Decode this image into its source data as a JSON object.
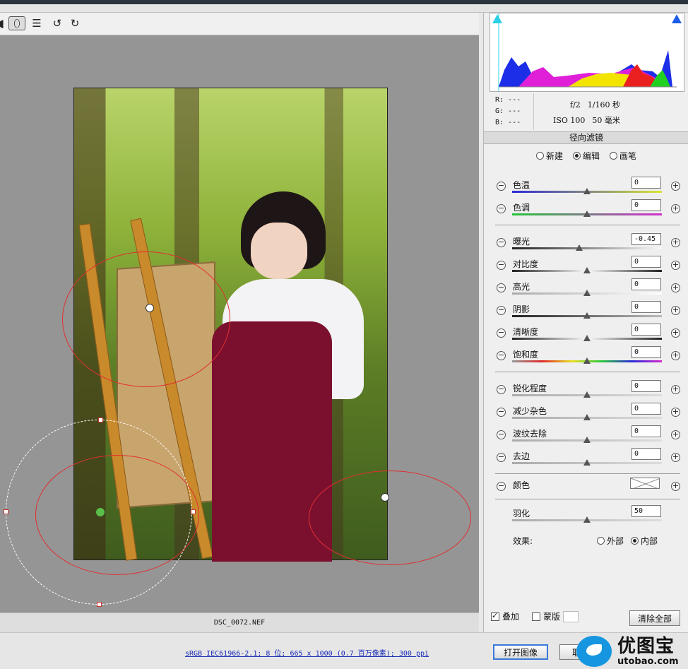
{
  "toolbar": {
    "icons": [
      "zoom-icon",
      "radial-filter-icon",
      "list-icon",
      "rotate-left-icon",
      "rotate-right-icon"
    ],
    "active": "radial-filter-icon"
  },
  "canvas": {
    "filename": "DSC_0072.NEF"
  },
  "info": {
    "r": "R: ---",
    "g": "G: ---",
    "b": "B: ---",
    "aperture": "f/2",
    "shutter": "1/160 秒",
    "iso": "ISO 100",
    "focal": "50 毫米"
  },
  "panel": {
    "title": "径向滤镜",
    "modes": [
      {
        "label": "新建",
        "selected": false
      },
      {
        "label": "编辑",
        "selected": true
      },
      {
        "label": "画笔",
        "selected": false
      }
    ],
    "sliders": [
      {
        "label": "色温",
        "value": "0",
        "level": 0.5
      },
      {
        "label": "色调",
        "value": "0",
        "level": 0.5
      },
      {
        "label": "曝光",
        "value": "-0.45",
        "level": 0.45
      },
      {
        "label": "对比度",
        "value": "0",
        "level": 0.5
      },
      {
        "label": "高光",
        "value": "0",
        "level": 0.5
      },
      {
        "label": "阴影",
        "value": "0",
        "level": 0.5
      },
      {
        "label": "清晰度",
        "value": "0",
        "level": 0.5
      },
      {
        "label": "饱和度",
        "value": "0",
        "level": 0.5
      },
      {
        "label": "锐化程度",
        "value": "0",
        "level": 0.5
      },
      {
        "label": "减少杂色",
        "value": "0",
        "level": 0.5
      },
      {
        "label": "波纹去除",
        "value": "0",
        "level": 0.5
      },
      {
        "label": "去边",
        "value": "0",
        "level": 0.5
      }
    ],
    "color_label": "颜色",
    "feather_label": "羽化",
    "feather_value": "50",
    "feather_level": 0.5,
    "effect_label": "效果:",
    "effect_options": [
      {
        "label": "外部",
        "selected": false
      },
      {
        "label": "内部",
        "selected": true
      }
    ],
    "overlay_label": "叠加",
    "overlay_checked": true,
    "mask_label": "蒙版",
    "mask_checked": false,
    "clear_all": "清除全部"
  },
  "bottom": {
    "meta": "sRGB IEC61966-2.1; 8 位; 665 x 1000 (0.7 百万像素); 300 ppi",
    "open_image": "打开图像",
    "cancel": "取消"
  },
  "watermark": {
    "name": "优图宝",
    "url": "utobao.com"
  }
}
